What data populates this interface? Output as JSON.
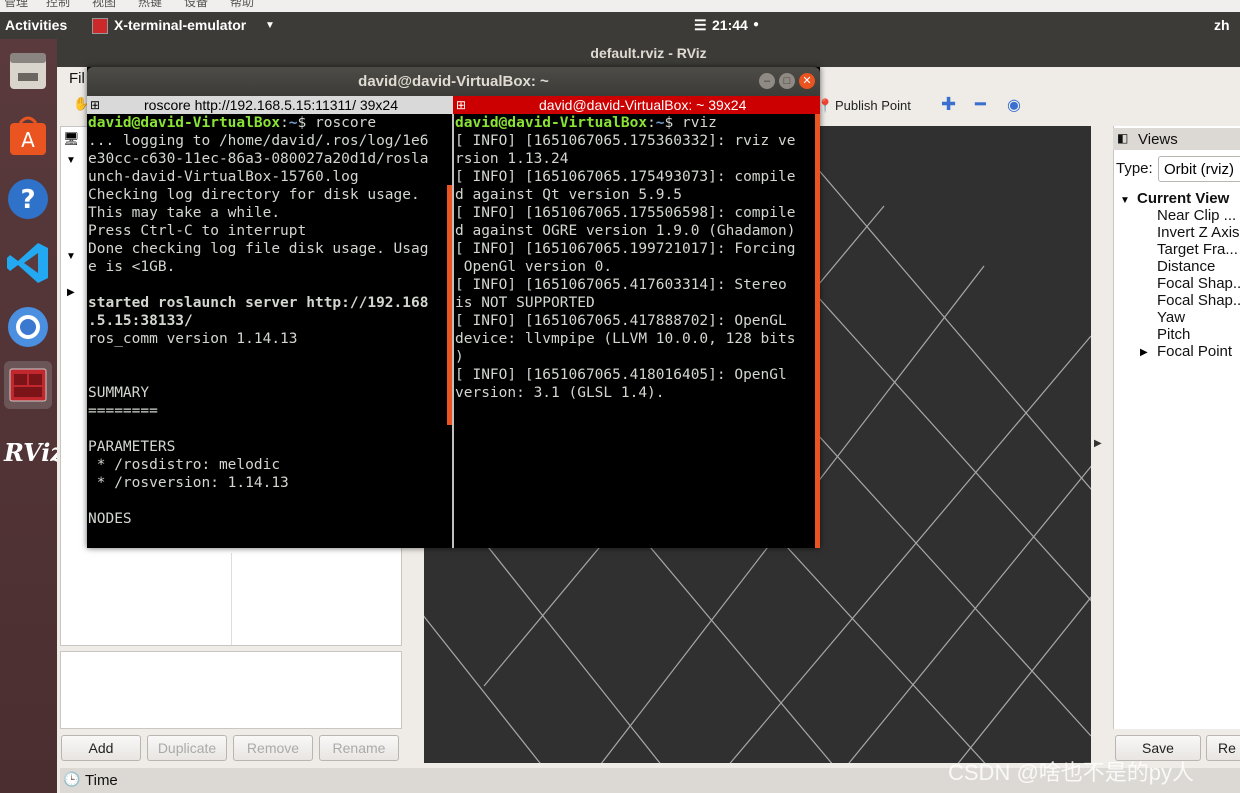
{
  "host_menu": {
    "items": [
      "管理",
      "控制",
      "视图",
      "热键",
      "设备",
      "帮助"
    ]
  },
  "topbar": {
    "activities": "Activities",
    "app_name": "X-terminal-emulator",
    "clock": "21:44",
    "lang": "zh"
  },
  "rviz": {
    "window_title": "default.rviz - RViz",
    "menu_file": "Fil",
    "toolbar": {
      "publish_point": "Publish Point"
    },
    "displays_buttons": [
      "Add",
      "Duplicate",
      "Remove",
      "Rename"
    ],
    "views": {
      "header": "Views",
      "type_label": "Type:",
      "type_value": "Orbit (rviz)",
      "current_view": "Current View",
      "properties": [
        "Near Clip ...",
        "Invert Z Axis",
        "Target Fra...",
        "Distance",
        "Focal Shap...",
        "Focal Shap...",
        "Yaw",
        "Pitch",
        "Focal Point"
      ],
      "save": "Save",
      "reset": "Re"
    },
    "time_label": "Time"
  },
  "terminal": {
    "window_title": "david@david-VirtualBox: ~",
    "left_tab": "roscore http://192.168.5.15:11311/ 39x24",
    "right_tab": "david@david-VirtualBox: ~ 39x24",
    "prompt_user": "david@david-VirtualBox",
    "prompt_sep": ":",
    "prompt_path": "~",
    "left_command": "$ roscore",
    "left_lines": [
      "... logging to /home/david/.ros/log/1e6",
      "e30cc-c630-11ec-86a3-080027a20d1d/rosla",
      "unch-david-VirtualBox-15760.log",
      "Checking log directory for disk usage.",
      "This may take a while.",
      "Press Ctrl-C to interrupt",
      "Done checking log file disk usage. Usag",
      "e is <1GB.",
      "",
      "started roslaunch server http://192.168",
      ".5.15:38133/",
      "ros_comm version 1.14.13",
      "",
      "",
      "SUMMARY",
      "========",
      "",
      "PARAMETERS",
      " * /rosdistro: melodic",
      " * /rosversion: 1.14.13",
      "",
      "NODES"
    ],
    "right_command": "$ rviz",
    "right_lines": [
      "[ INFO] [1651067065.175360332]: rviz ve",
      "rsion 1.13.24",
      "[ INFO] [1651067065.175493073]: compile",
      "d against Qt version 5.9.5",
      "[ INFO] [1651067065.175506598]: compile",
      "d against OGRE version 1.9.0 (Ghadamon)",
      "[ INFO] [1651067065.199721017]: Forcing",
      " OpenGl version 0.",
      "[ INFO] [1651067065.417603314]: Stereo",
      "is NOT SUPPORTED",
      "[ INFO] [1651067065.417888702]: OpenGL",
      "device: llvmpipe (LLVM 10.0.0, 128 bits",
      ")",
      "[ INFO] [1651067065.418016405]: OpenGl",
      "version: 3.1 (GLSL 1.4)."
    ]
  },
  "launcher": {
    "rviz_label": "RViz"
  },
  "watermark": "CSDN @啥也不是的py人",
  "colors": {
    "ubuntu_orange": "#e95420",
    "terminal_bg": "#000000",
    "prompt_green": "#8ae234",
    "prompt_blue": "#729fcf",
    "active_tab_red": "#cc0000"
  }
}
